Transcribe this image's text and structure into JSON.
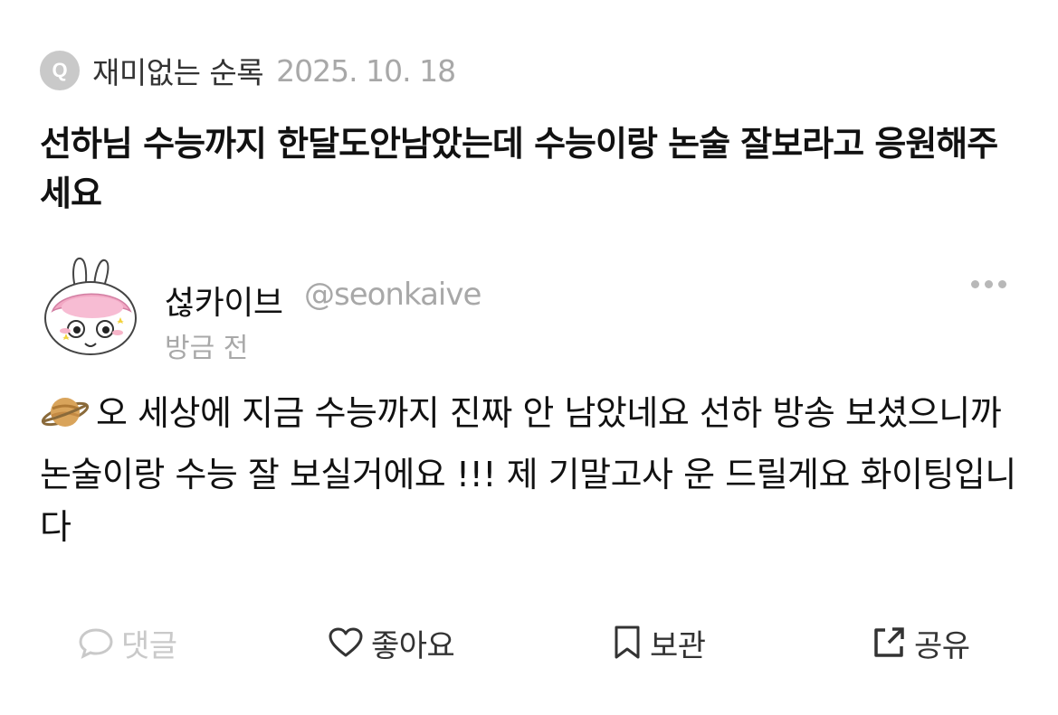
{
  "question": {
    "badge": "Q",
    "asker": "재미없는 순록",
    "date": "2025. 10. 18",
    "text": "선하님 수능까지 한달도안남았는데 수능이랑 논술 잘보라고 응원해주세요"
  },
  "answer": {
    "author_name": "섢카이브",
    "author_handle": "@seonkaive",
    "time": "방금 전",
    "emoji_icon": "ringed-planet-icon",
    "text": "오 세상에 지금 수능까지 진짜 안 남았네요 선하 방송 보셨으니까 논술이랑 수능 잘 보실거에요 !!! 제 기말고사 운 드릴게요 화이팅입니다"
  },
  "actions": {
    "comment_label": "댓글",
    "like_label": "좋아요",
    "save_label": "보관",
    "share_label": "공유"
  },
  "colors": {
    "muted": "#a8a8a8",
    "disabled": "#c9c9c9",
    "text": "#111111"
  }
}
